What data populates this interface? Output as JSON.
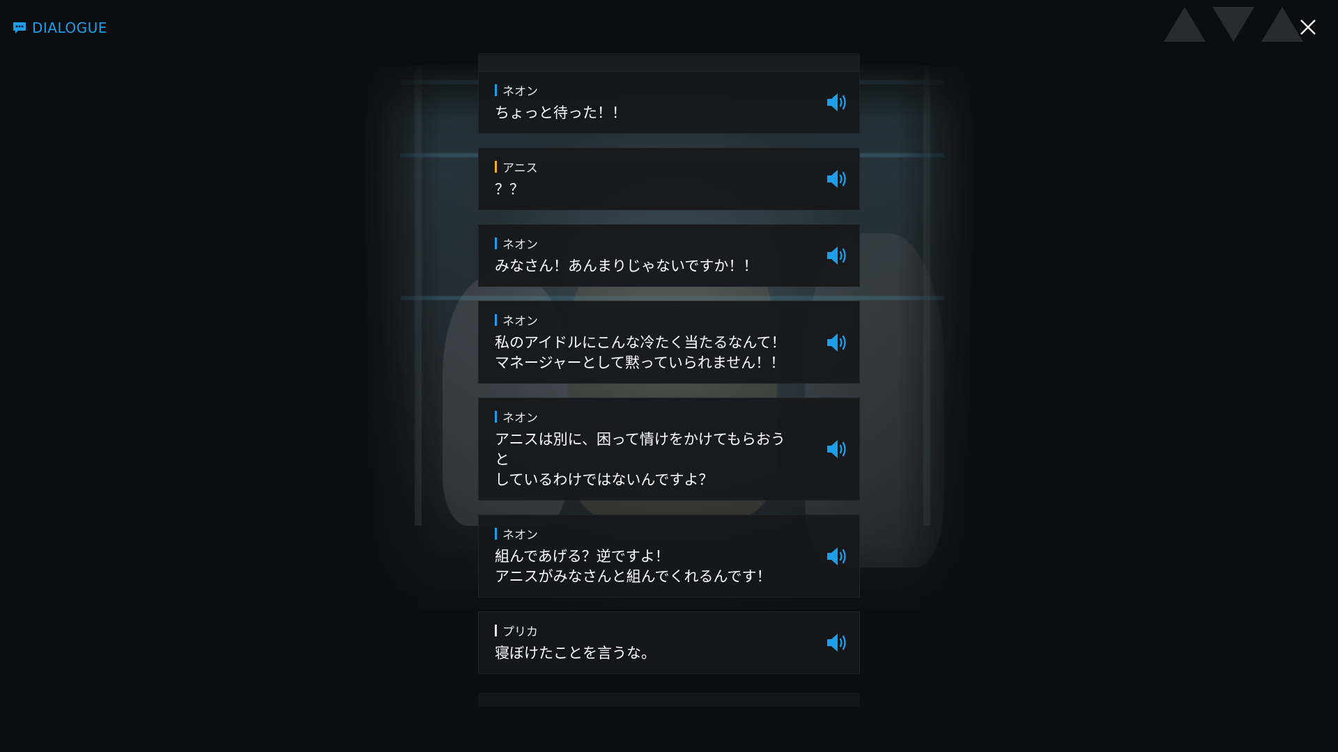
{
  "header": {
    "title": "DIALOGUE",
    "title_icon": "chat-bubble-icon",
    "close_icon": "close-icon",
    "accent_color": "#1e9eea"
  },
  "dialogue": [
    {
      "speaker": "ネオン",
      "speaker_color": "#1e9eea",
      "text": "ちょっと待った！！",
      "voice_icon": "speaker-volume-icon"
    },
    {
      "speaker": "アニス",
      "speaker_color": "#f2b01e",
      "text": "？？",
      "voice_icon": "speaker-volume-icon"
    },
    {
      "speaker": "ネオン",
      "speaker_color": "#1e9eea",
      "text": "みなさん！あんまりじゃないですか！！",
      "voice_icon": "speaker-volume-icon"
    },
    {
      "speaker": "ネオン",
      "speaker_color": "#1e9eea",
      "text": "私のアイドルにこんな冷たく当たるなんて！\nマネージャーとして黙っていられません！！",
      "voice_icon": "speaker-volume-icon"
    },
    {
      "speaker": "ネオン",
      "speaker_color": "#1e9eea",
      "text": "アニスは別に、困って情けをかけてもらおうと\nしているわけではないんですよ？",
      "voice_icon": "speaker-volume-icon"
    },
    {
      "speaker": "ネオン",
      "speaker_color": "#1e9eea",
      "text": "組んであげる？逆ですよ！\nアニスがみなさんと組んでくれるんです！",
      "voice_icon": "speaker-volume-icon"
    },
    {
      "speaker": "プリカ",
      "speaker_color": "#e6e6e6",
      "text": "寝ぼけたことを言うな。",
      "voice_icon": "speaker-volume-icon"
    }
  ]
}
